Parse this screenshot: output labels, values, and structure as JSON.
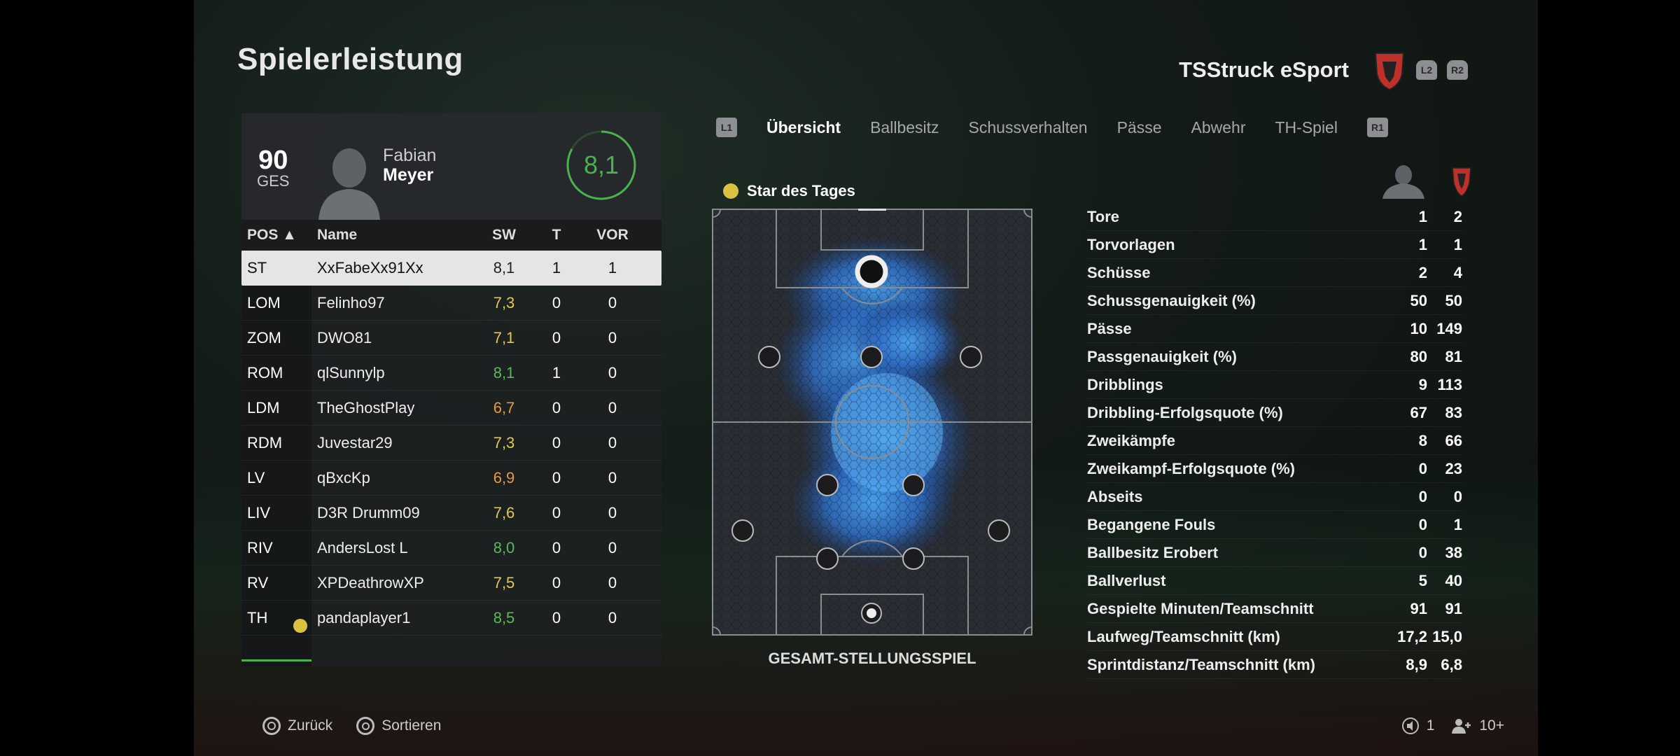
{
  "page": {
    "title": "Spielerleistung"
  },
  "team": {
    "name": "TSStruck eSport",
    "buttons": [
      "L2",
      "R2"
    ],
    "crest_color": "#c0302a"
  },
  "player": {
    "overall": "90",
    "overall_label": "GES",
    "first_name": "Fabian",
    "last_name": "Meyer",
    "rating": "8,1"
  },
  "table": {
    "headers": {
      "pos": "POS ▲",
      "name": "Name",
      "sw": "SW",
      "t": "T",
      "vor": "VOR"
    },
    "rows": [
      {
        "pos": "ST",
        "name": "XxFabeXx91Xx",
        "sw": "8,1",
        "t": "1",
        "vor": "1",
        "color": "#222222",
        "selected": true
      },
      {
        "pos": "LOM",
        "name": "Felinho97",
        "sw": "7,3",
        "t": "0",
        "vor": "0",
        "color": "#e6c84a"
      },
      {
        "pos": "ZOM",
        "name": "DWO81",
        "sw": "7,1",
        "t": "0",
        "vor": "0",
        "color": "#e6c84a"
      },
      {
        "pos": "ROM",
        "name": "qlSunnylp",
        "sw": "8,1",
        "t": "1",
        "vor": "0",
        "color": "#5cb85c"
      },
      {
        "pos": "LDM",
        "name": "TheGhostPlay",
        "sw": "6,7",
        "t": "0",
        "vor": "0",
        "color": "#e89a3c"
      },
      {
        "pos": "RDM",
        "name": "Juvestar29",
        "sw": "7,3",
        "t": "0",
        "vor": "0",
        "color": "#e6c84a"
      },
      {
        "pos": "LV",
        "name": "qBxcKp",
        "sw": "6,9",
        "t": "0",
        "vor": "0",
        "color": "#e89a3c"
      },
      {
        "pos": "LIV",
        "name": "D3R Drumm09",
        "sw": "7,6",
        "t": "0",
        "vor": "0",
        "color": "#e6c84a"
      },
      {
        "pos": "RIV",
        "name": "AndersLost L",
        "sw": "8,0",
        "t": "0",
        "vor": "0",
        "color": "#5cb85c"
      },
      {
        "pos": "RV",
        "name": "XPDeathrowXP",
        "sw": "7,5",
        "t": "0",
        "vor": "0",
        "color": "#e6c84a"
      },
      {
        "pos": "TH",
        "name": "pandaplayer1",
        "sw": "8,5",
        "t": "0",
        "vor": "0",
        "color": "#5cb85c",
        "star": true
      }
    ]
  },
  "tabs": {
    "left_button": "L1",
    "right_button": "R1",
    "items": [
      "Übersicht",
      "Ballbesitz",
      "Schussverhalten",
      "Pässe",
      "Abwehr",
      "TH-Spiel"
    ],
    "active": 0
  },
  "pitch": {
    "star_label": "Star des Tages",
    "caption": "GESAMT-STELLUNGSSPIEL"
  },
  "stats": [
    {
      "name": "Tore",
      "player": "1",
      "team": "2"
    },
    {
      "name": "Torvorlagen",
      "player": "1",
      "team": "1"
    },
    {
      "name": "Schüsse",
      "player": "2",
      "team": "4"
    },
    {
      "name": "Schussgenauigkeit (%)",
      "player": "50",
      "team": "50"
    },
    {
      "name": "Pässe",
      "player": "10",
      "team": "149"
    },
    {
      "name": "Passgenauigkeit (%)",
      "player": "80",
      "team": "81"
    },
    {
      "name": "Dribblings",
      "player": "9",
      "team": "113"
    },
    {
      "name": "Dribbling-Erfolgsquote (%)",
      "player": "67",
      "team": "83"
    },
    {
      "name": "Zweikämpfe",
      "player": "8",
      "team": "66"
    },
    {
      "name": "Zweikampf-Erfolgsquote (%)",
      "player": "0",
      "team": "23"
    },
    {
      "name": "Abseits",
      "player": "0",
      "team": "0"
    },
    {
      "name": "Begangene Fouls",
      "player": "0",
      "team": "1"
    },
    {
      "name": "Ballbesitz Erobert",
      "player": "0",
      "team": "38"
    },
    {
      "name": "Ballverlust",
      "player": "5",
      "team": "40"
    },
    {
      "name": "Gespielte Minuten/Teamschnitt",
      "player": "91",
      "team": "91"
    },
    {
      "name": "Laufweg/Teamschnitt (km)",
      "player": "17,2",
      "team": "15,0"
    },
    {
      "name": "Sprintdistanz/Teamschnitt (km)",
      "player": "8,9",
      "team": "6,8"
    }
  ],
  "footer": {
    "back": "Zurück",
    "sort": "Sortieren",
    "count_a": "1",
    "count_b": "10+"
  }
}
